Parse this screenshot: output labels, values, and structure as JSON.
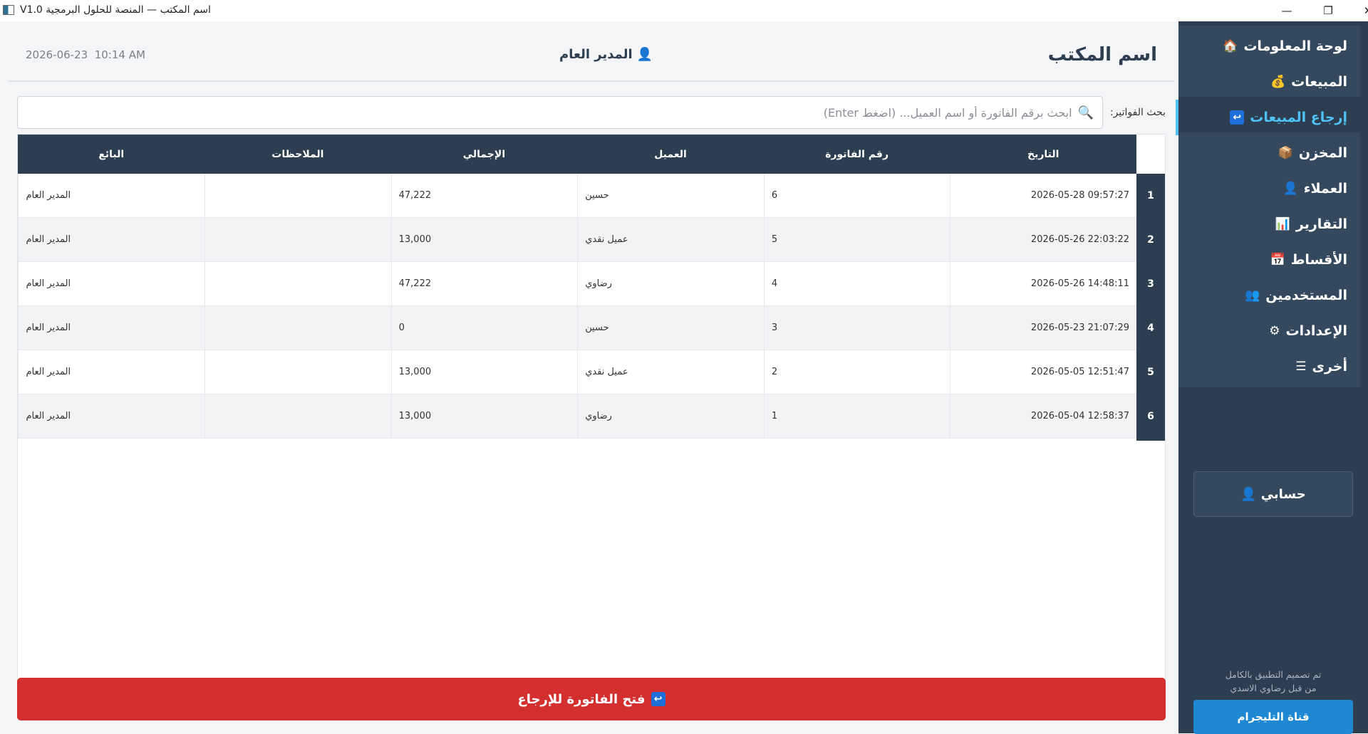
{
  "window": {
    "title": "V1.0 اسم المكتب — المنصة للحلول البرمجية",
    "minimize_icon": "minimize-icon",
    "restore_icon": "restore-icon",
    "close_icon": "close-icon"
  },
  "header": {
    "office_name": "اسم المكتب",
    "user": "المدير العام",
    "user_icon": "user-icon",
    "datetime": "2026-06-23  10:14 AM"
  },
  "search": {
    "label": "بحث الفواتير:",
    "placeholder": "ابحث برقم الفاتورة أو اسم العميل... (اضغط Enter)",
    "value": ""
  },
  "table": {
    "columns": [
      "التاريخ",
      "رقم الفاتورة",
      "العميل",
      "الإجمالي",
      "الملاحظات",
      "البائع"
    ],
    "rows": [
      {
        "num": "1",
        "date": "2026-05-28 09:57:27",
        "invoice": "6",
        "customer": "حسين",
        "total": "47,222",
        "notes": "",
        "seller": "المدير العام"
      },
      {
        "num": "2",
        "date": "2026-05-26 22:03:22",
        "invoice": "5",
        "customer": "عميل نقدي",
        "total": "13,000",
        "notes": "",
        "seller": "المدير العام"
      },
      {
        "num": "3",
        "date": "2026-05-26 14:48:11",
        "invoice": "4",
        "customer": "رضاوي",
        "total": "47,222",
        "notes": "",
        "seller": "المدير العام"
      },
      {
        "num": "4",
        "date": "2026-05-23 21:07:29",
        "invoice": "3",
        "customer": "حسين",
        "total": "0",
        "notes": "",
        "seller": "المدير العام"
      },
      {
        "num": "5",
        "date": "2026-05-05 12:51:47",
        "invoice": "2",
        "customer": "عميل نقدي",
        "total": "13,000",
        "notes": "",
        "seller": "المدير العام"
      },
      {
        "num": "6",
        "date": "2026-05-04 12:58:37",
        "invoice": "1",
        "customer": "رضاوي",
        "total": "13,000",
        "notes": "",
        "seller": "المدير العام"
      }
    ]
  },
  "actions": {
    "open_invoice": "فتح الفاتورة للإرجاع"
  },
  "sidebar": {
    "items": [
      {
        "label": "لوحة المعلومات",
        "icon": "🏠"
      },
      {
        "label": "المبيعات",
        "icon": "💰"
      },
      {
        "label": "إرجاع المبيعات",
        "icon": "↩"
      },
      {
        "label": "المخزن",
        "icon": "📦"
      },
      {
        "label": "العملاء",
        "icon": "👤"
      },
      {
        "label": "التقارير",
        "icon": "📊"
      },
      {
        "label": "الأقساط",
        "icon": "📅"
      },
      {
        "label": "المستخدمين",
        "icon": "👥"
      },
      {
        "label": "الإعدادات",
        "icon": "⚙"
      },
      {
        "label": "أخرى",
        "icon": "☰"
      }
    ],
    "active_index": 2,
    "account": "حسابي",
    "credit_line1": "تم تصميم التطبيق بالكامل",
    "credit_line2": "من قبل رضاوي الاسدي",
    "telegram": "قناة التليجرام"
  },
  "colors": {
    "sidebar_bg": "#2c3e50",
    "active_accent": "#4fc3f7",
    "danger": "#d32f2f",
    "telegram": "#1e88d2"
  }
}
